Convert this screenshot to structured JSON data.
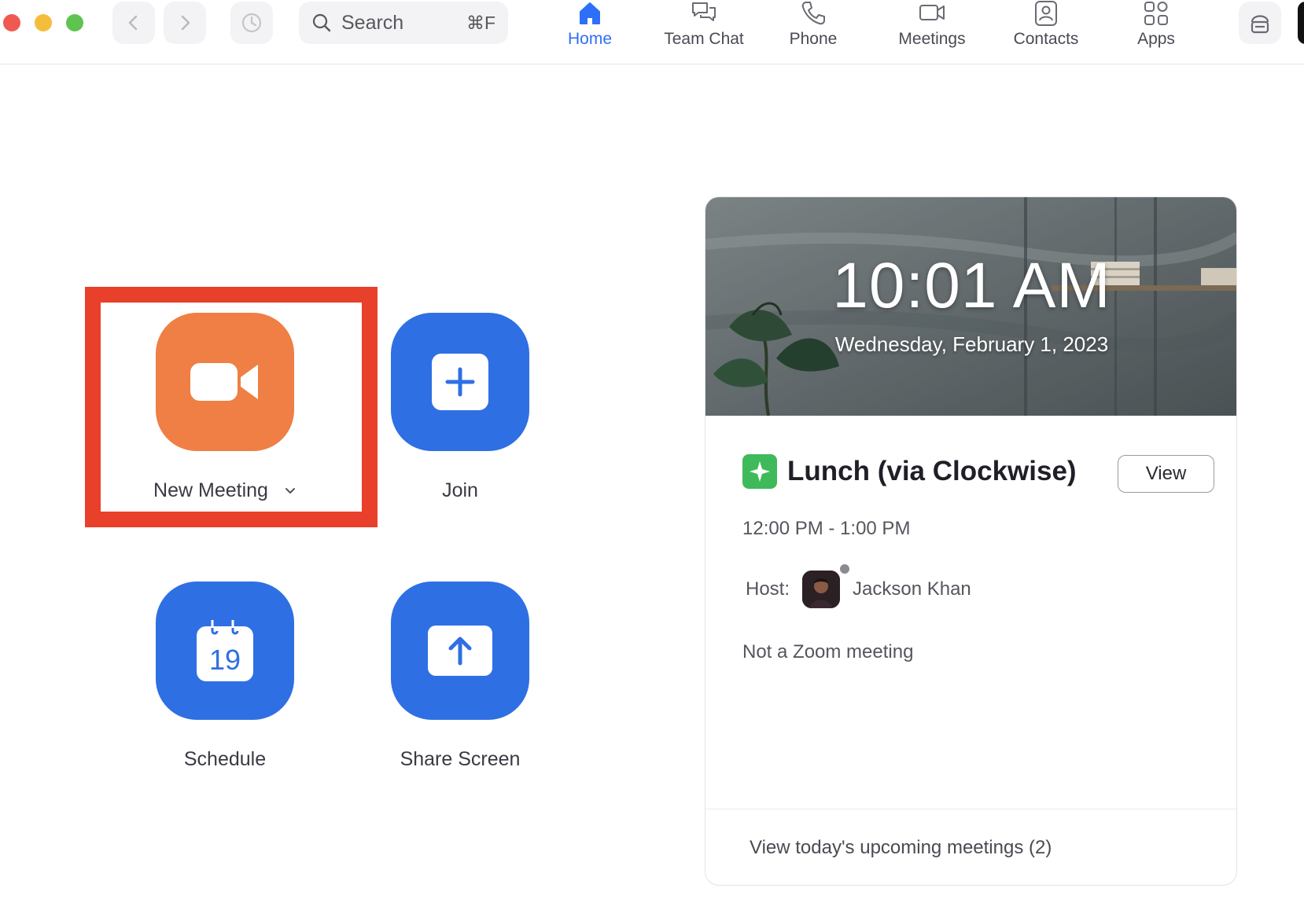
{
  "toolbar": {
    "search_placeholder": "Search",
    "search_shortcut": "⌘F",
    "tabs": [
      {
        "label": "Home",
        "icon": "home-icon",
        "active": true
      },
      {
        "label": "Team Chat",
        "icon": "chat-icon",
        "active": false
      },
      {
        "label": "Phone",
        "icon": "phone-icon",
        "active": false
      },
      {
        "label": "Meetings",
        "icon": "video-camera-icon",
        "active": false
      },
      {
        "label": "Contacts",
        "icon": "contacts-icon",
        "active": false
      },
      {
        "label": "Apps",
        "icon": "apps-icon",
        "active": false
      }
    ]
  },
  "actions": {
    "new_meeting": "New Meeting",
    "join": "Join",
    "schedule": "Schedule",
    "schedule_day": "19",
    "share_screen": "Share Screen"
  },
  "card": {
    "time": "10:01 AM",
    "date": "Wednesday, February 1, 2023",
    "event": {
      "title": "Lunch (via Clockwise)",
      "view_label": "View",
      "time_range": "12:00 PM - 1:00 PM",
      "host_label": "Host:",
      "host_name": "Jackson Khan",
      "note": "Not a Zoom meeting"
    },
    "footer_link": "View today's upcoming meetings (2)"
  },
  "colors": {
    "accent_blue": "#2f6fe4",
    "tab_active": "#2d6ff6",
    "new_meeting_orange": "#ef7f44",
    "highlight_red": "#e8402a",
    "event_green": "#3fba5a"
  }
}
